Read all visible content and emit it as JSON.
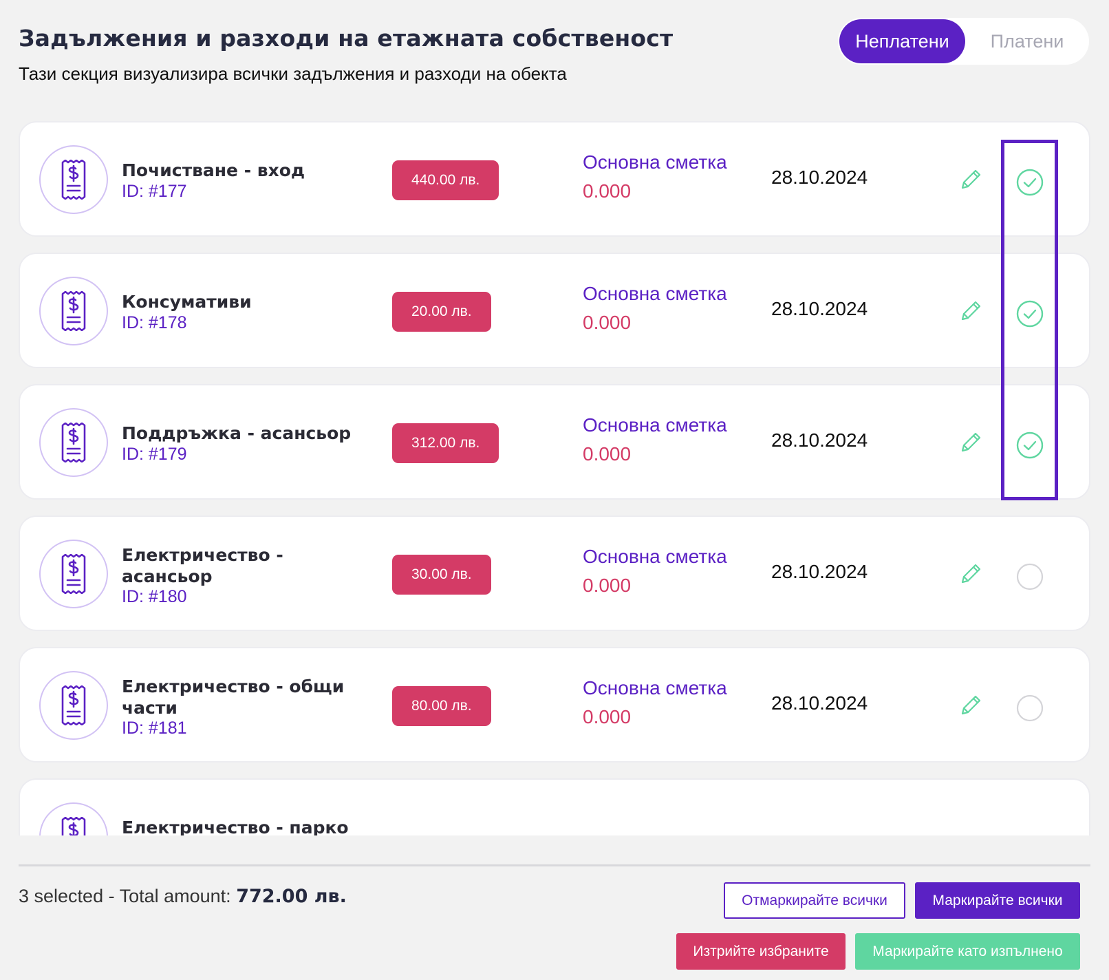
{
  "header": {
    "title": "Задължения и разходи на етажната собственост",
    "subtitle": "Тази секция визуализира всички задължения и разходи на обекта"
  },
  "toggle": {
    "unpaid_label": "Неплатени",
    "paid_label": "Платени",
    "active": "unpaid"
  },
  "items": [
    {
      "name": "Почистване - вход",
      "id": "ID: #177",
      "amount": "440.00 лв.",
      "account": "Основна сметка",
      "account_value": "0.000",
      "date": "28.10.2024",
      "checked": true
    },
    {
      "name": "Консумативи",
      "id": "ID: #178",
      "amount": "20.00 лв.",
      "account": "Основна сметка",
      "account_value": "0.000",
      "date": "28.10.2024",
      "checked": true
    },
    {
      "name": "Поддръжка - асансьор",
      "id": "ID: #179",
      "amount": "312.00 лв.",
      "account": "Основна сметка",
      "account_value": "0.000",
      "date": "28.10.2024",
      "checked": true
    },
    {
      "name": "Електричество - асансьор",
      "id": "ID: #180",
      "amount": "30.00 лв.",
      "account": "Основна сметка",
      "account_value": "0.000",
      "date": "28.10.2024",
      "checked": false
    },
    {
      "name": "Електричество - общи части",
      "id": "ID: #181",
      "amount": "80.00 лв.",
      "account": "Основна сметка",
      "account_value": "0.000",
      "date": "28.10.2024",
      "checked": false
    },
    {
      "name": "Електричество - парко",
      "id": "",
      "amount": "",
      "account": "",
      "account_value": "",
      "date": "",
      "checked": false
    }
  ],
  "footer": {
    "selected_text": "3 selected - Total amount: ",
    "total": "772.00 лв.",
    "unmark_all_label": "Отмаркирайте всички",
    "mark_all_label": "Маркирайте всички",
    "delete_selected_label": "Изтрийте избраните",
    "mark_done_label": "Маркирайте като изпълнено"
  },
  "colors": {
    "accent": "#5b21c4",
    "danger": "#d43b66",
    "success": "#5fd6a0"
  },
  "icons": {
    "item": "receipt-dollar-icon",
    "edit": "pencil-icon",
    "checked": "check-circle-icon",
    "unchecked": "empty-circle-icon"
  }
}
